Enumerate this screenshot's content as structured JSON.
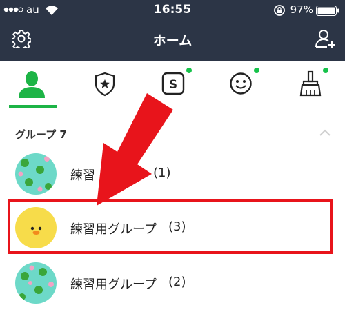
{
  "status_bar": {
    "carrier": "au",
    "time": "16:55",
    "battery": "97%"
  },
  "header": {
    "title": "ホーム",
    "settings_icon": "gear-icon",
    "add_friend_icon": "add-person-icon"
  },
  "tabs": [
    {
      "name": "friends",
      "icon": "person-icon",
      "active": true,
      "badge": false
    },
    {
      "name": "official",
      "icon": "shield-star-icon",
      "active": false,
      "badge": false
    },
    {
      "name": "stickers-shop",
      "icon": "s-box-icon",
      "active": false,
      "badge": true
    },
    {
      "name": "emoji",
      "icon": "smiley-icon",
      "active": false,
      "badge": true
    },
    {
      "name": "themes",
      "icon": "brush-icon",
      "active": false,
      "badge": true
    }
  ],
  "groups_section": {
    "title": "グループ 7",
    "collapse_icon": "chevron-up-icon",
    "items": [
      {
        "name_visible": "練習",
        "name_tail": "(1)",
        "avatar": "frog-pattern"
      },
      {
        "name_visible": "練習用グループ",
        "name_tail": "(3)",
        "avatar": "duck"
      },
      {
        "name_visible": "練習用グループ",
        "name_tail": "(2)",
        "avatar": "frog-pattern"
      }
    ]
  },
  "colors": {
    "header_bg": "#2c3546",
    "accent_green": "#1db446",
    "badge_green": "#16c24a",
    "annotation_red": "#e8141b",
    "avatar_teal": "#6dd9c8",
    "avatar_yellow": "#f7dc4a"
  }
}
